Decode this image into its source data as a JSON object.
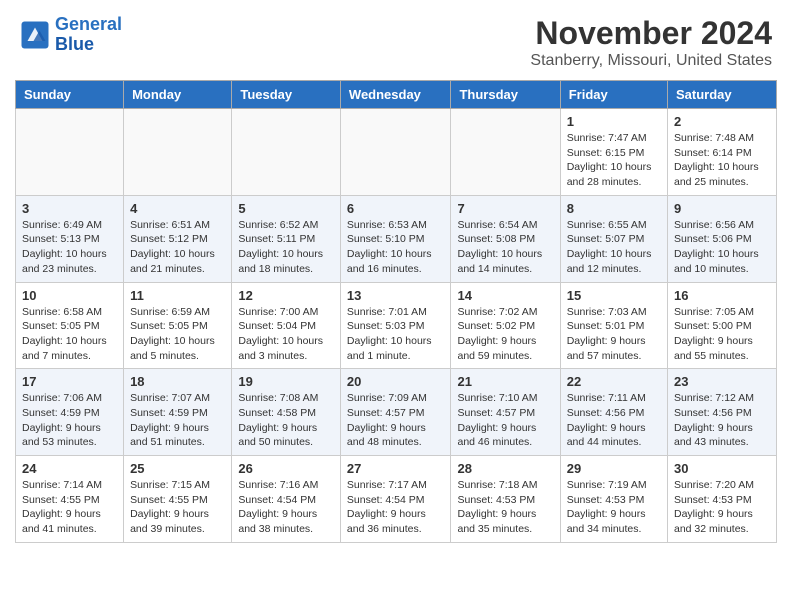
{
  "header": {
    "logo_line1": "General",
    "logo_line2": "Blue",
    "main_title": "November 2024",
    "subtitle": "Stanberry, Missouri, United States"
  },
  "weekdays": [
    "Sunday",
    "Monday",
    "Tuesday",
    "Wednesday",
    "Thursday",
    "Friday",
    "Saturday"
  ],
  "weeks": [
    [
      {
        "day": "",
        "info": ""
      },
      {
        "day": "",
        "info": ""
      },
      {
        "day": "",
        "info": ""
      },
      {
        "day": "",
        "info": ""
      },
      {
        "day": "",
        "info": ""
      },
      {
        "day": "1",
        "info": "Sunrise: 7:47 AM\nSunset: 6:15 PM\nDaylight: 10 hours\nand 28 minutes."
      },
      {
        "day": "2",
        "info": "Sunrise: 7:48 AM\nSunset: 6:14 PM\nDaylight: 10 hours\nand 25 minutes."
      }
    ],
    [
      {
        "day": "3",
        "info": "Sunrise: 6:49 AM\nSunset: 5:13 PM\nDaylight: 10 hours\nand 23 minutes."
      },
      {
        "day": "4",
        "info": "Sunrise: 6:51 AM\nSunset: 5:12 PM\nDaylight: 10 hours\nand 21 minutes."
      },
      {
        "day": "5",
        "info": "Sunrise: 6:52 AM\nSunset: 5:11 PM\nDaylight: 10 hours\nand 18 minutes."
      },
      {
        "day": "6",
        "info": "Sunrise: 6:53 AM\nSunset: 5:10 PM\nDaylight: 10 hours\nand 16 minutes."
      },
      {
        "day": "7",
        "info": "Sunrise: 6:54 AM\nSunset: 5:08 PM\nDaylight: 10 hours\nand 14 minutes."
      },
      {
        "day": "8",
        "info": "Sunrise: 6:55 AM\nSunset: 5:07 PM\nDaylight: 10 hours\nand 12 minutes."
      },
      {
        "day": "9",
        "info": "Sunrise: 6:56 AM\nSunset: 5:06 PM\nDaylight: 10 hours\nand 10 minutes."
      }
    ],
    [
      {
        "day": "10",
        "info": "Sunrise: 6:58 AM\nSunset: 5:05 PM\nDaylight: 10 hours\nand 7 minutes."
      },
      {
        "day": "11",
        "info": "Sunrise: 6:59 AM\nSunset: 5:05 PM\nDaylight: 10 hours\nand 5 minutes."
      },
      {
        "day": "12",
        "info": "Sunrise: 7:00 AM\nSunset: 5:04 PM\nDaylight: 10 hours\nand 3 minutes."
      },
      {
        "day": "13",
        "info": "Sunrise: 7:01 AM\nSunset: 5:03 PM\nDaylight: 10 hours\nand 1 minute."
      },
      {
        "day": "14",
        "info": "Sunrise: 7:02 AM\nSunset: 5:02 PM\nDaylight: 9 hours\nand 59 minutes."
      },
      {
        "day": "15",
        "info": "Sunrise: 7:03 AM\nSunset: 5:01 PM\nDaylight: 9 hours\nand 57 minutes."
      },
      {
        "day": "16",
        "info": "Sunrise: 7:05 AM\nSunset: 5:00 PM\nDaylight: 9 hours\nand 55 minutes."
      }
    ],
    [
      {
        "day": "17",
        "info": "Sunrise: 7:06 AM\nSunset: 4:59 PM\nDaylight: 9 hours\nand 53 minutes."
      },
      {
        "day": "18",
        "info": "Sunrise: 7:07 AM\nSunset: 4:59 PM\nDaylight: 9 hours\nand 51 minutes."
      },
      {
        "day": "19",
        "info": "Sunrise: 7:08 AM\nSunset: 4:58 PM\nDaylight: 9 hours\nand 50 minutes."
      },
      {
        "day": "20",
        "info": "Sunrise: 7:09 AM\nSunset: 4:57 PM\nDaylight: 9 hours\nand 48 minutes."
      },
      {
        "day": "21",
        "info": "Sunrise: 7:10 AM\nSunset: 4:57 PM\nDaylight: 9 hours\nand 46 minutes."
      },
      {
        "day": "22",
        "info": "Sunrise: 7:11 AM\nSunset: 4:56 PM\nDaylight: 9 hours\nand 44 minutes."
      },
      {
        "day": "23",
        "info": "Sunrise: 7:12 AM\nSunset: 4:56 PM\nDaylight: 9 hours\nand 43 minutes."
      }
    ],
    [
      {
        "day": "24",
        "info": "Sunrise: 7:14 AM\nSunset: 4:55 PM\nDaylight: 9 hours\nand 41 minutes."
      },
      {
        "day": "25",
        "info": "Sunrise: 7:15 AM\nSunset: 4:55 PM\nDaylight: 9 hours\nand 39 minutes."
      },
      {
        "day": "26",
        "info": "Sunrise: 7:16 AM\nSunset: 4:54 PM\nDaylight: 9 hours\nand 38 minutes."
      },
      {
        "day": "27",
        "info": "Sunrise: 7:17 AM\nSunset: 4:54 PM\nDaylight: 9 hours\nand 36 minutes."
      },
      {
        "day": "28",
        "info": "Sunrise: 7:18 AM\nSunset: 4:53 PM\nDaylight: 9 hours\nand 35 minutes."
      },
      {
        "day": "29",
        "info": "Sunrise: 7:19 AM\nSunset: 4:53 PM\nDaylight: 9 hours\nand 34 minutes."
      },
      {
        "day": "30",
        "info": "Sunrise: 7:20 AM\nSunset: 4:53 PM\nDaylight: 9 hours\nand 32 minutes."
      }
    ]
  ]
}
